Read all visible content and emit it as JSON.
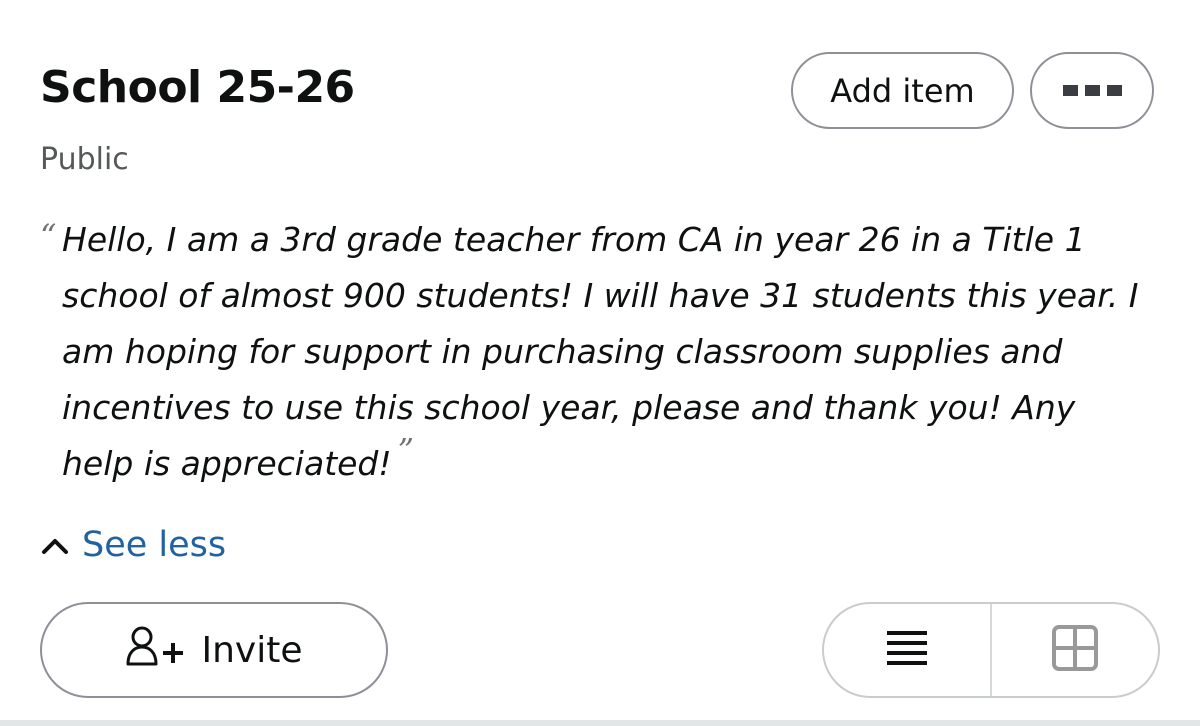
{
  "list": {
    "title": "School 25-26",
    "visibility": "Public",
    "description": "Hello, I am a 3rd grade teacher from CA in year 26 in a Title 1 school of almost 900 students! I will have 31 students this year. I am hoping for support in purchasing classroom supplies and incentives to use this school year, please and thank you! Any help is appreciated!",
    "quote_open": "“",
    "quote_close": "”"
  },
  "actions": {
    "add_item_label": "Add item",
    "more_icon": "more-icon",
    "see_less_label": "See less",
    "see_less_icon": "chevron-up-icon",
    "invite_label": "Invite",
    "invite_icon": "add-person-icon"
  },
  "view_toggle": {
    "list_icon": "list-view-icon",
    "grid_icon": "grid-view-icon"
  },
  "colors": {
    "link": "#2162a1",
    "muted_text": "#565959",
    "border": "#8d9096"
  }
}
